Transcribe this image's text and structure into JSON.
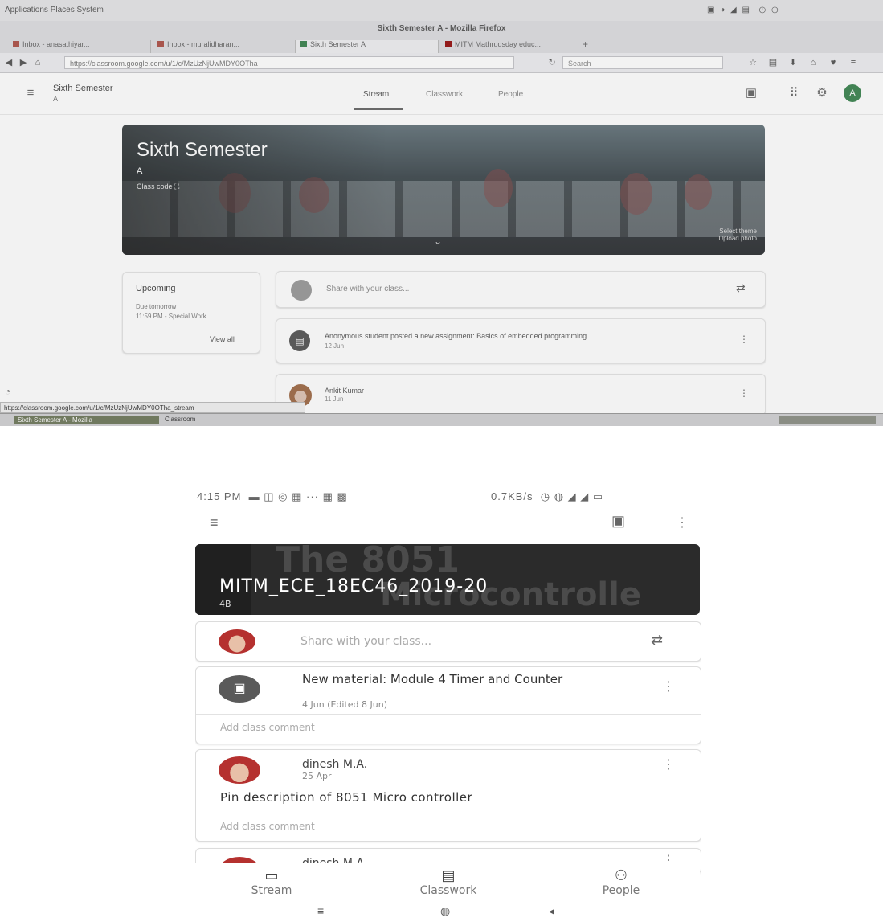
{
  "desktop": {
    "window_title": "Sixth Semester A - Mozilla Firefox",
    "titlebar_left": "Applications Places System",
    "tabs": [
      {
        "label": "Inbox - anasathiyar...",
        "color": "#d44638"
      },
      {
        "label": "Inbox - muralidharan...",
        "color": "#d44638"
      },
      {
        "label": "Sixth Semester A",
        "color": "#1e8e3e"
      },
      {
        "label": "MITM Mathrudsday educ...",
        "color": "#cc0000"
      }
    ],
    "url": "https://classroom.google.com/u/1/c/MzUzNjUwMDY0OTha",
    "search_placeholder": "Search",
    "class_header": {
      "name": "Sixth Semester",
      "section": "A"
    },
    "nav_tabs": [
      "Stream",
      "Classwork",
      "People"
    ],
    "avatar_letter": "A",
    "banner": {
      "title": "Sixth Semester",
      "subtitle": "A",
      "class_code_label": "Class code",
      "class_code": "",
      "select_theme": "Select theme",
      "upload_photo": "Upload photo"
    },
    "upcoming": {
      "title": "Upcoming",
      "line1": "Due tomorrow",
      "line2": "11:59 PM - Special Work",
      "view_all": "View all"
    },
    "share_placeholder": "Share with your class...",
    "posts": [
      {
        "text": "Anonymous student posted a new assignment: Basics of embedded programming",
        "date": "12 Jun"
      },
      {
        "author": "Ankit Kumar",
        "date": "11 Jun"
      }
    ],
    "status_link": "https://classroom.google.com/u/1/c/MzUzNjUwMDY0OTha_stream",
    "taskbar_item": "Sixth Semester A - Mozilla",
    "taskbar_item2": "Classroom"
  },
  "phone": {
    "status_time": "4:15 PM",
    "status_right": "0.7KB/s",
    "hero_bg_line1": "The 8051",
    "hero_bg_line2": "Microcontrolle",
    "class_name": "MITM_ECE_18EC46_2019-20",
    "section": "4B",
    "share_placeholder": "Share with your class...",
    "posts": [
      {
        "title": "New material: Module 4 Timer and Counter",
        "date": "4 Jun (Edited 8 Jun)",
        "comment": "Add class comment"
      },
      {
        "author": "dinesh M.A.",
        "date": "25 Apr",
        "body": "Pin description of 8051 Micro controller",
        "comment": "Add class comment"
      },
      {
        "author": "dinesh M.A."
      }
    ],
    "bottom_nav": [
      "Stream",
      "Classwork",
      "People"
    ]
  }
}
